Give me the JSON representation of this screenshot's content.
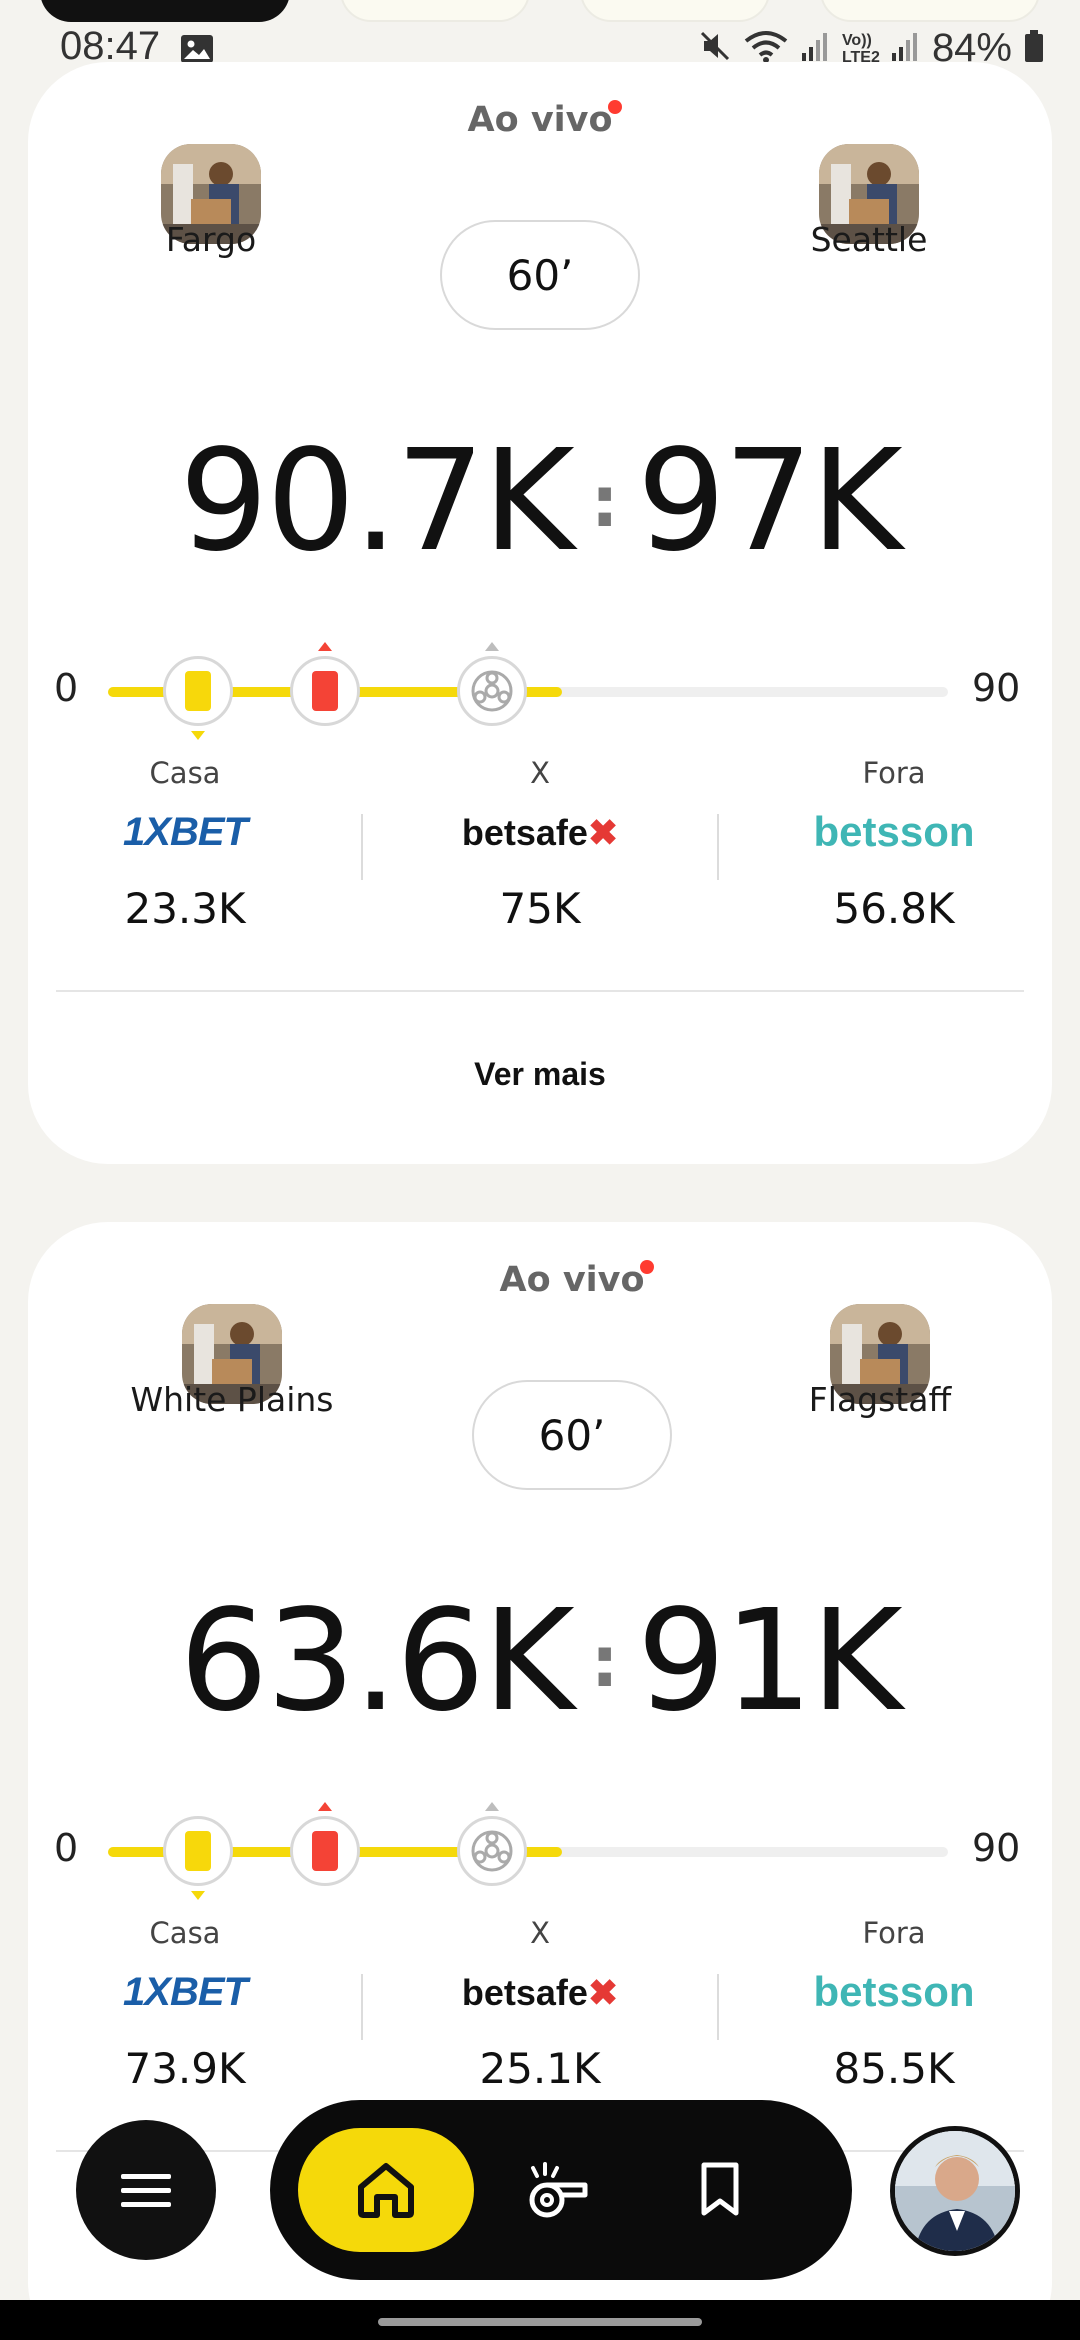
{
  "status_bar": {
    "time": "08:47",
    "battery": "84%",
    "network_label": "Vo)) LTE2"
  },
  "matches": [
    {
      "live_label": "Ao vivo",
      "minute": "60’",
      "home_team": "Fargo",
      "away_team": "Seattle",
      "home_score": "90.7K",
      "away_score": "97K",
      "timeline": {
        "start": "0",
        "end": "90",
        "progress_fraction": 0.54,
        "events": [
          "yellow-card",
          "red-card",
          "ball"
        ]
      },
      "odds": [
        {
          "label": "Casa",
          "bookmaker": "1XBET",
          "value": "23.3K"
        },
        {
          "label": "X",
          "bookmaker": "betsafe",
          "value": "75K"
        },
        {
          "label": "Fora",
          "bookmaker": "betsson",
          "value": "56.8K"
        }
      ],
      "see_more": "Ver mais"
    },
    {
      "live_label": "Ao vivo",
      "minute": "60’",
      "home_team": "White Plains",
      "away_team": "Flagstaff",
      "home_score": "63.6K",
      "away_score": "91K",
      "timeline": {
        "start": "0",
        "end": "90",
        "progress_fraction": 0.54,
        "events": [
          "yellow-card",
          "red-card",
          "ball"
        ]
      },
      "odds": [
        {
          "label": "Casa",
          "bookmaker": "1XBET",
          "value": "73.9K"
        },
        {
          "label": "X",
          "bookmaker": "betsafe",
          "value": "25.1K"
        },
        {
          "label": "Fora",
          "bookmaker": "betsson",
          "value": "85.5K"
        }
      ]
    }
  ],
  "nav": {
    "items": [
      "menu-icon",
      "home-icon",
      "whistle-icon",
      "bookmark-icon"
    ],
    "active": "home-icon"
  },
  "colors": {
    "accent": "#f5d90a",
    "red": "#f44336",
    "live_dot": "#ff3b30",
    "nav_bg": "#0b0b0b"
  }
}
